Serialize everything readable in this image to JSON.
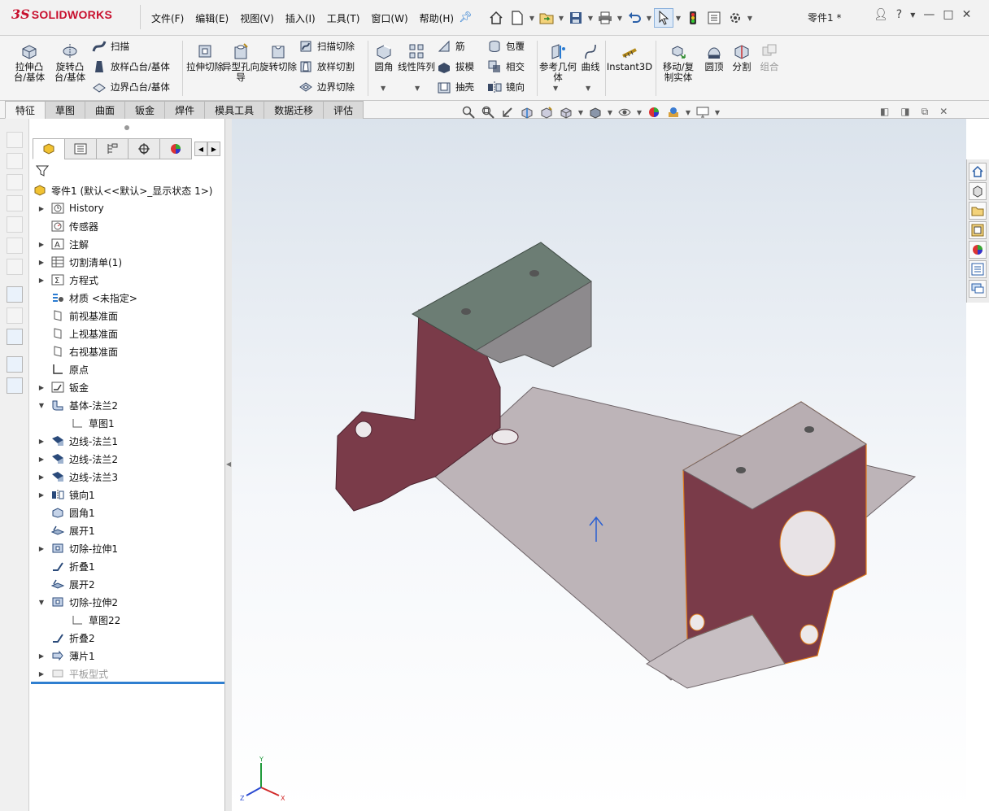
{
  "app": {
    "logo_mark": "3S",
    "brand": "SOLIDWORKS",
    "document_title": "零件1 *"
  },
  "menu": [
    {
      "label": "文件(F)"
    },
    {
      "label": "编辑(E)"
    },
    {
      "label": "视图(V)"
    },
    {
      "label": "插入(I)"
    },
    {
      "label": "工具(T)"
    },
    {
      "label": "窗口(W)"
    },
    {
      "label": "帮助(H)"
    }
  ],
  "commands": {
    "extrude_boss": "拉伸凸台/基体",
    "revolve_boss": "旋转凸台/基体",
    "sweep": "扫描",
    "loft": "放样凸台/基体",
    "boundary": "边界凸台/基体",
    "extrude_cut": "拉伸切除",
    "hole_wizard": "异型孔向导",
    "revolve_cut": "旋转切除",
    "swept_cut": "扫描切除",
    "lofted_cut": "放样切割",
    "boundary_cut": "边界切除",
    "fillet": "圆角",
    "linear_pattern": "线性阵列",
    "rib": "筋",
    "draft": "拔模",
    "shell": "抽壳",
    "wrap": "包覆",
    "intersect": "相交",
    "mirror": "镜向",
    "ref_geometry": "参考几何体",
    "curves": "曲线",
    "instant3d": "Instant3D",
    "move_copy": "移动/复制实体",
    "dome": "圆顶",
    "split": "分割",
    "combine": "组合"
  },
  "tabs": [
    {
      "label": "特征"
    },
    {
      "label": "草图"
    },
    {
      "label": "曲面"
    },
    {
      "label": "钣金"
    },
    {
      "label": "焊件"
    },
    {
      "label": "模具工具"
    },
    {
      "label": "数据迁移"
    },
    {
      "label": "评估"
    }
  ],
  "tree": {
    "root": "零件1 (默认<<默认>_显示状态 1>)",
    "items": [
      {
        "label": "History",
        "icon": "history-icon"
      },
      {
        "label": "传感器",
        "icon": "sensor-icon"
      },
      {
        "label": "注解",
        "icon": "annotation-icon"
      },
      {
        "label": "切割清单(1)",
        "icon": "cut-list-icon"
      },
      {
        "label": "方程式",
        "icon": "equation-icon"
      },
      {
        "label": "材质 <未指定>",
        "icon": "material-icon"
      },
      {
        "label": "前视基准面",
        "icon": "plane-icon"
      },
      {
        "label": "上视基准面",
        "icon": "plane-icon"
      },
      {
        "label": "右视基准面",
        "icon": "plane-icon"
      },
      {
        "label": "原点",
        "icon": "origin-icon"
      },
      {
        "label": "钣金",
        "icon": "sheet-metal-icon"
      },
      {
        "label": "基体-法兰2",
        "icon": "base-flange-icon"
      },
      {
        "label": "草图1",
        "icon": "sketch-icon"
      },
      {
        "label": "边线-法兰1",
        "icon": "edge-flange-icon"
      },
      {
        "label": "边线-法兰2",
        "icon": "edge-flange-icon"
      },
      {
        "label": "边线-法兰3",
        "icon": "edge-flange-icon"
      },
      {
        "label": "镜向1",
        "icon": "mirror-icon"
      },
      {
        "label": "圆角1",
        "icon": "fillet-icon"
      },
      {
        "label": "展开1",
        "icon": "unfold-icon"
      },
      {
        "label": "切除-拉伸1",
        "icon": "cut-extrude-icon"
      },
      {
        "label": "折叠1",
        "icon": "fold-icon"
      },
      {
        "label": "展开2",
        "icon": "unfold-icon"
      },
      {
        "label": "切除-拉伸2",
        "icon": "cut-extrude-icon"
      },
      {
        "label": "草图22",
        "icon": "sketch-icon"
      },
      {
        "label": "折叠2",
        "icon": "fold-icon"
      },
      {
        "label": "薄片1",
        "icon": "tab-icon"
      },
      {
        "label": "平板型式",
        "icon": "flat-pattern-icon"
      }
    ]
  },
  "triad": {
    "x": "X",
    "y": "Y",
    "z": "Z"
  },
  "colors": {
    "accent": "#2f7fd0",
    "brand_red": "#c8102e",
    "part_face": "#b8aeb2",
    "part_selected": "#7a3b49",
    "edge_highlight": "#e07b1a"
  }
}
